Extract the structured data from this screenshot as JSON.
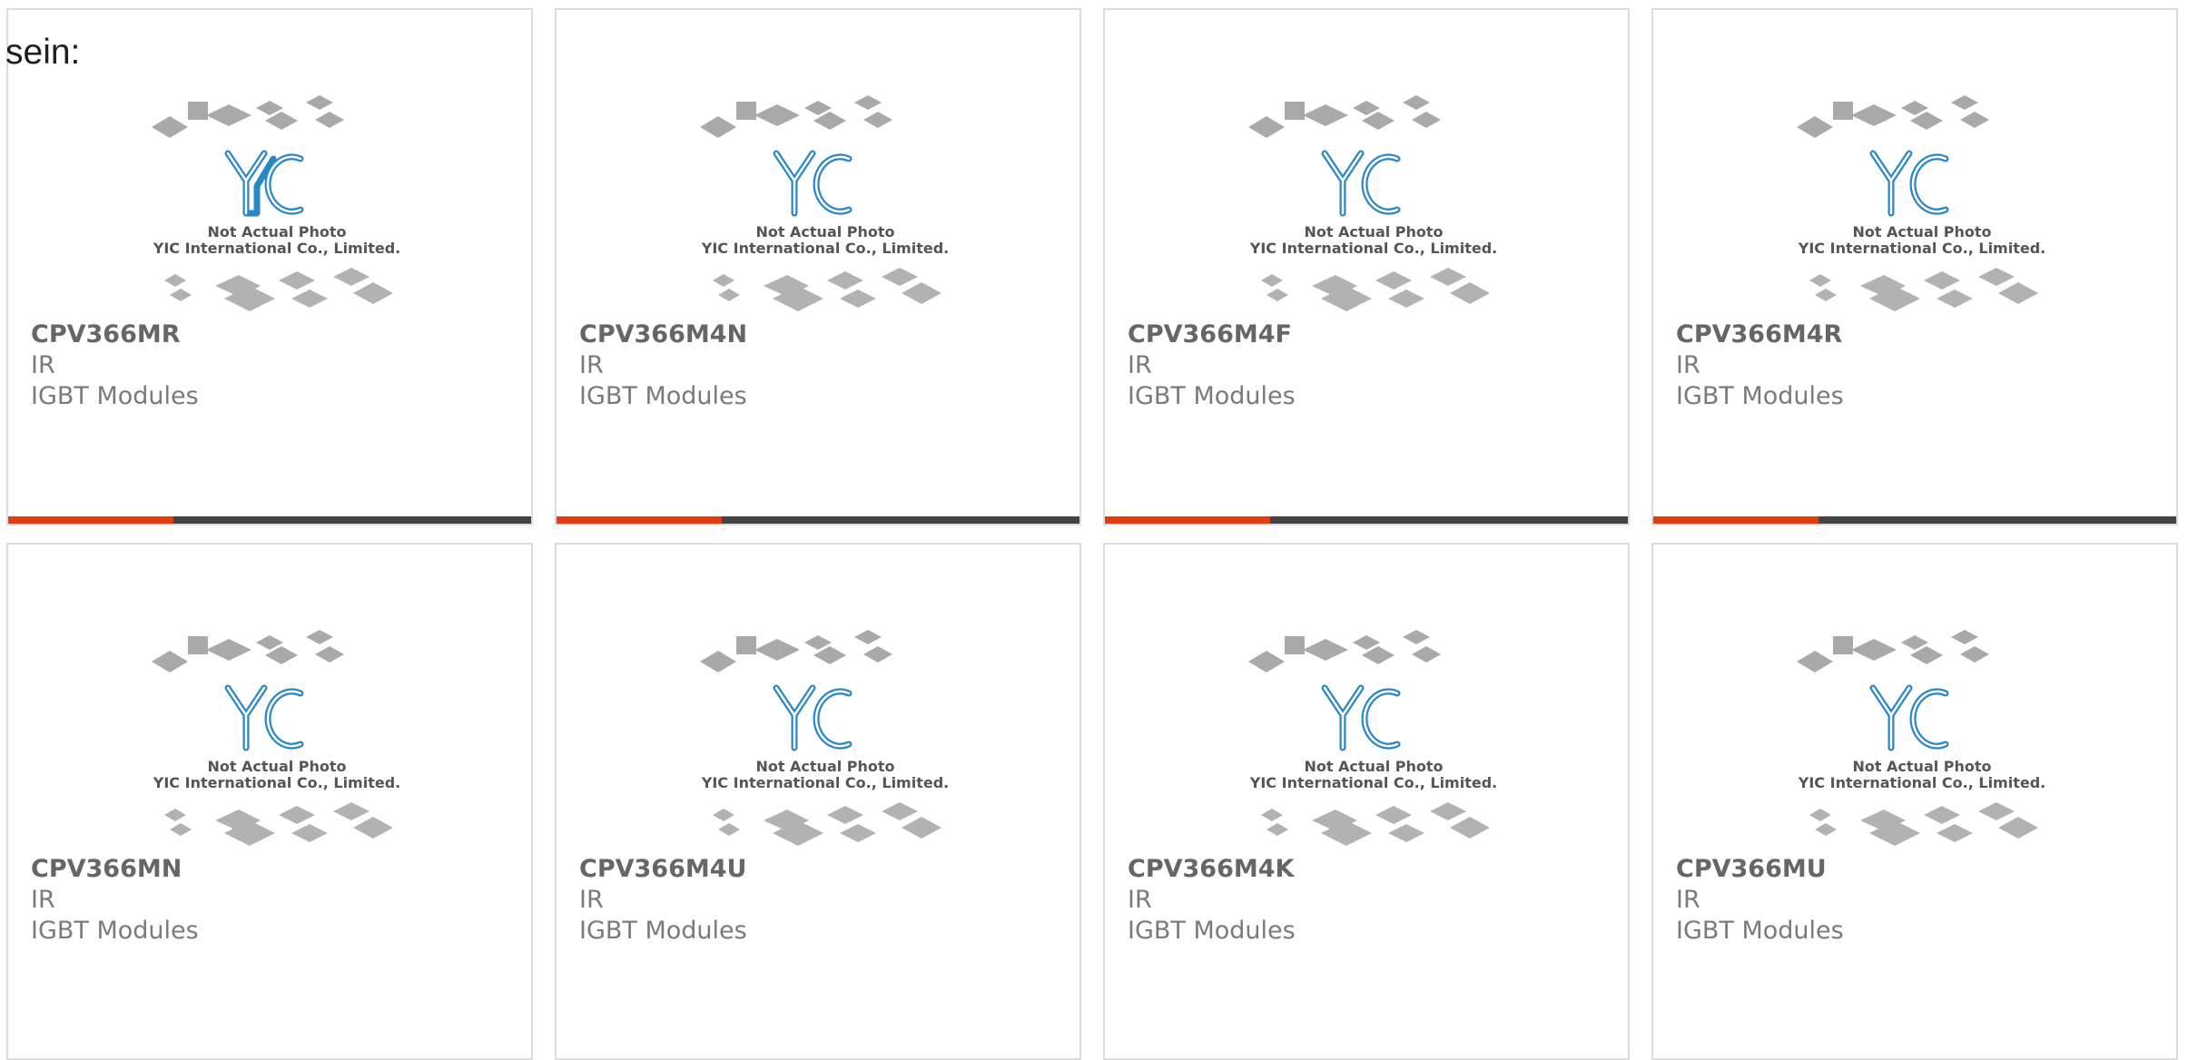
{
  "intro_text": "sein:",
  "placeholder": {
    "line1": "Not Actual Photo",
    "line2": "YIC International Co., Limited.",
    "logo": "YIC"
  },
  "products": [
    {
      "part": "CPV366MR",
      "manufacturer": "IR",
      "category": "IGBT Modules"
    },
    {
      "part": "CPV366M4N",
      "manufacturer": "IR",
      "category": "IGBT Modules"
    },
    {
      "part": "CPV366M4F",
      "manufacturer": "IR",
      "category": "IGBT Modules"
    },
    {
      "part": "CPV366M4R",
      "manufacturer": "IR",
      "category": "IGBT Modules"
    },
    {
      "part": "CPV366MN",
      "manufacturer": "IR",
      "category": "IGBT Modules"
    },
    {
      "part": "CPV366M4U",
      "manufacturer": "IR",
      "category": "IGBT Modules"
    },
    {
      "part": "CPV366M4K",
      "manufacturer": "IR",
      "category": "IGBT Modules"
    },
    {
      "part": "CPV366MU",
      "manufacturer": "IR",
      "category": "IGBT Modules"
    }
  ],
  "colors": {
    "accent": "#e23d10",
    "bar": "#444444",
    "logo_blue": "#2a87c6"
  }
}
